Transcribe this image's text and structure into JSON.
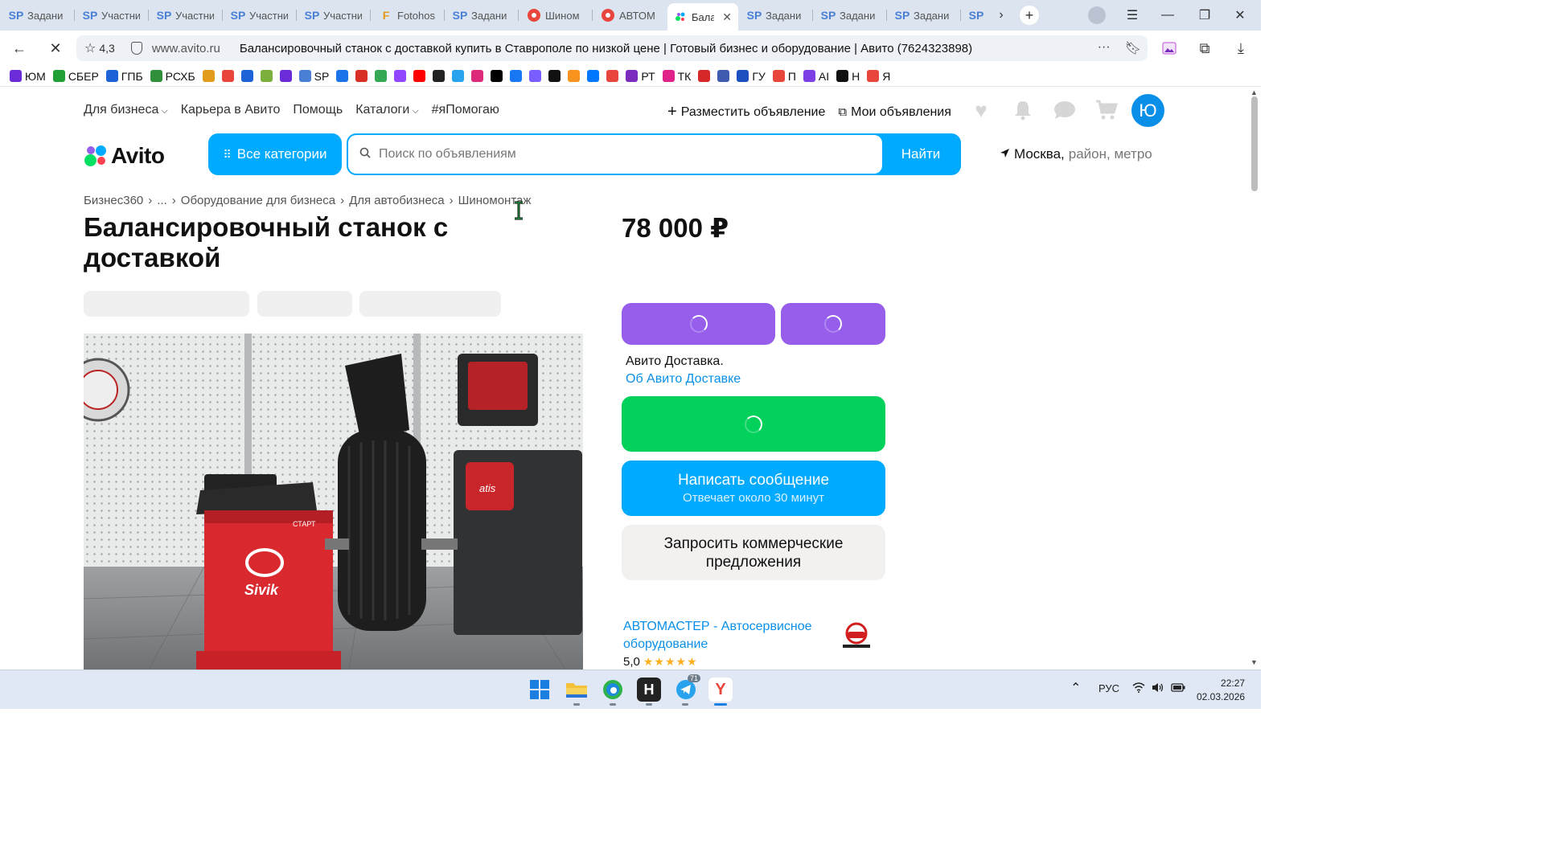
{
  "browser": {
    "tabs": [
      {
        "icon": "sp",
        "label": "Задани"
      },
      {
        "icon": "sp",
        "label": "Участни"
      },
      {
        "icon": "sp",
        "label": "Участни"
      },
      {
        "icon": "sp",
        "label": "Участни"
      },
      {
        "icon": "sp",
        "label": "Участни"
      },
      {
        "icon": "fh",
        "label": "Fotohos"
      },
      {
        "icon": "sp",
        "label": "Задани"
      },
      {
        "icon": "red",
        "label": "Шином"
      },
      {
        "icon": "red",
        "label": "АВТОМ"
      },
      {
        "icon": "av",
        "label": "Бала"
      },
      {
        "icon": "sp",
        "label": "Задани"
      },
      {
        "icon": "sp",
        "label": "Задани"
      },
      {
        "icon": "sp",
        "label": "Задани"
      },
      {
        "icon": "sp",
        "label": ""
      }
    ],
    "rating": "4,3",
    "domain": "www.avito.ru",
    "page_title": "Балансировочный станок с доставкой купить в Ставрополе по низкой цене | Готовый бизнес и оборудование | Авито (7624323898)",
    "bookmarks": [
      {
        "label": "ЮМ",
        "color": "#6b2bd9"
      },
      {
        "label": "СБЕР",
        "color": "#21a038"
      },
      {
        "label": "ГПБ",
        "color": "#1d62d6"
      },
      {
        "label": "РСХБ",
        "color": "#2f8f3a"
      },
      {
        "label": "",
        "color": "#e39b1b"
      },
      {
        "label": "",
        "color": "#e8453c"
      },
      {
        "label": "",
        "color": "#1d62d6"
      },
      {
        "label": "",
        "color": "#7bb03d"
      },
      {
        "label": "",
        "color": "#6b2bd9"
      },
      {
        "label": "SP",
        "color": "#4a7fd6"
      },
      {
        "label": "",
        "color": "#1a73e8"
      },
      {
        "label": "",
        "color": "#d93025"
      },
      {
        "label": "",
        "color": "#34a853"
      },
      {
        "label": "",
        "color": "#9146ff"
      },
      {
        "label": "",
        "color": "#ff0000"
      },
      {
        "label": "",
        "color": "#222222"
      },
      {
        "label": "",
        "color": "#2aa3ef"
      },
      {
        "label": "",
        "color": "#dd2a7b"
      },
      {
        "label": "",
        "color": "#000000"
      },
      {
        "label": "",
        "color": "#1877f2"
      },
      {
        "label": "",
        "color": "#7a5cff"
      },
      {
        "label": "",
        "color": "#111111"
      },
      {
        "label": "",
        "color": "#f7931e"
      },
      {
        "label": "",
        "color": "#0077ff"
      },
      {
        "label": "",
        "color": "#e8453c"
      },
      {
        "label": "РТ",
        "color": "#7b2cbf"
      },
      {
        "label": "ТК",
        "color": "#e0218a"
      },
      {
        "label": "",
        "color": "#d62828"
      },
      {
        "label": "",
        "color": "#3f5bb0"
      },
      {
        "label": "ГУ",
        "color": "#1c4fbf"
      },
      {
        "label": "П",
        "color": "#e8453c"
      },
      {
        "label": "AI",
        "color": "#7b3fe4"
      },
      {
        "label": "Н",
        "color": "#111111"
      },
      {
        "label": "Я",
        "color": "#e8453c"
      }
    ]
  },
  "header": {
    "links": [
      "Для бизнеса",
      "Карьера в Авито",
      "Помощь",
      "Каталоги",
      "#яПомогаю"
    ],
    "post_ad": "Разместить объявление",
    "my_ads": "Мои объявления",
    "avatar_letter": "Ю",
    "logo_text": "Avito",
    "categories_label": "Все категории",
    "search_placeholder": "Поиск по объявлениям",
    "search_button": "Найти",
    "location_city": "Москва,",
    "location_hint": "район, метро"
  },
  "breadcrumbs": [
    "Бизнес360",
    "...",
    "Оборудование для бизнеса",
    "Для автобизнеса",
    "Шиномонтаж"
  ],
  "listing": {
    "title": "Балансировочный станок с доставкой",
    "price": "78 000 ₽",
    "delivery_text": "Авито Доставка.",
    "delivery_link": "Об Авито Доставке",
    "message_button": "Написать сообщение",
    "message_sub": "Отвечает около 30 минут",
    "commercial_button": "Запросить коммерческие предложения",
    "seller_name": "АВТОМАСТЕР - Автосервисное оборудование",
    "seller_rating": "5,0",
    "seller_rating_stars": 5,
    "photo_texts": {
      "brand": "Sivik",
      "start": "СТАРТ",
      "other_brand": "atis"
    }
  },
  "colors": {
    "accent_blue": "#00aaff",
    "purple": "#965eeb",
    "green": "#02d15c",
    "link_blue": "#0a8fe8"
  },
  "taskbar": {
    "telegram_badge": "71",
    "language": "РУС",
    "time": "22:27",
    "date": "02.03.2026"
  }
}
